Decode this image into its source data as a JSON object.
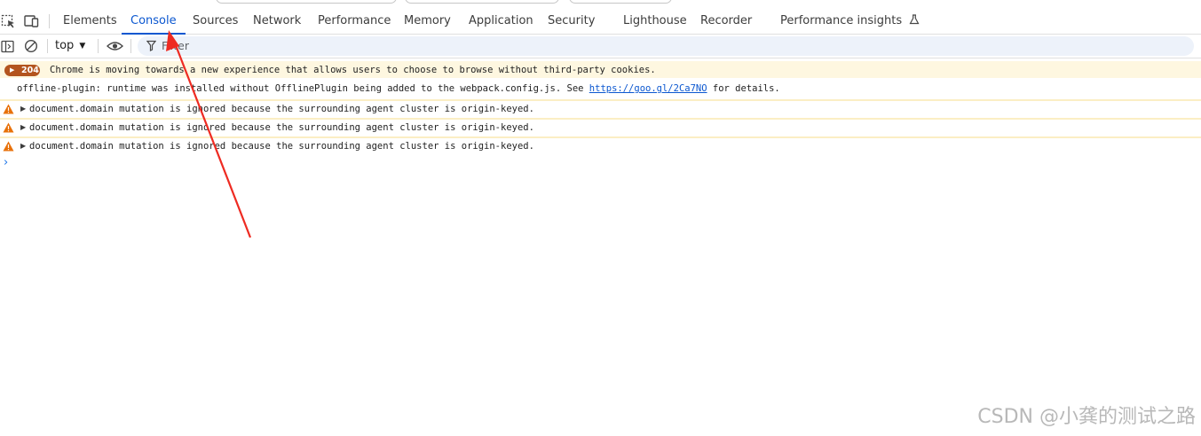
{
  "tabs": [
    {
      "label": "Elements",
      "active": false
    },
    {
      "label": "Console",
      "active": true
    },
    {
      "label": "Sources",
      "active": false
    },
    {
      "label": "Network",
      "active": false
    },
    {
      "label": "Performance",
      "active": false
    },
    {
      "label": "Memory",
      "active": false
    },
    {
      "label": "Application",
      "active": false
    },
    {
      "label": "Security",
      "active": false
    },
    {
      "label": "Lighthouse",
      "active": false
    },
    {
      "label": "Recorder",
      "active": false
    },
    {
      "label": "Performance insights",
      "active": false
    }
  ],
  "toolbar": {
    "context": "top",
    "filter_placeholder": "Filter"
  },
  "console": {
    "issue": {
      "count": "204",
      "text": "Chrome is moving towards a new experience that allows users to choose to browse without third-party cookies."
    },
    "log": {
      "text_before": "offline-plugin: runtime was installed without OfflinePlugin being added to the webpack.config.js. See ",
      "link": "https://goo.gl/2Ca7NO",
      "text_after": " for details."
    },
    "warnings": [
      "document.domain mutation is ignored because the surrounding agent cluster is origin-keyed.",
      "document.domain mutation is ignored because the surrounding agent cluster is origin-keyed.",
      "document.domain mutation is ignored because the surrounding agent cluster is origin-keyed."
    ],
    "prompt": "›"
  },
  "watermark": "CSDN @小龚的测试之路",
  "colors": {
    "accent": "#0b57d0",
    "warning_bg": "#fef7e0",
    "warning_icon": "#e8710a",
    "issue_badge": "#b3541e",
    "annotation_arrow": "#ee2b22"
  }
}
